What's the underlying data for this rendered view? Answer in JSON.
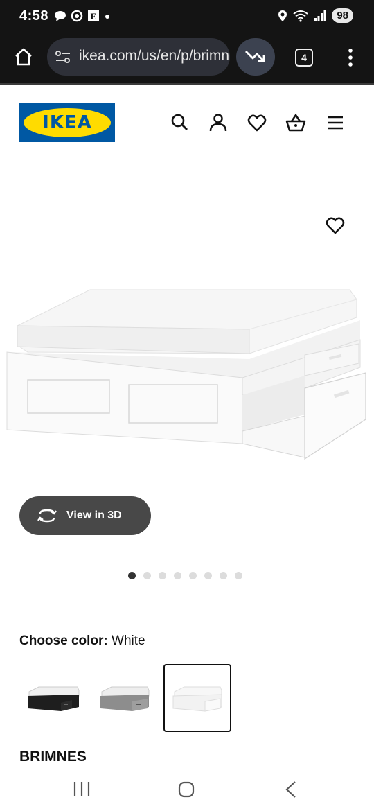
{
  "status_bar": {
    "time": "4:58",
    "battery": "98"
  },
  "browser": {
    "url": "ikea.com/us/en/p/brimnes",
    "tab_count": "4"
  },
  "header": {
    "logo_text": "IKEA"
  },
  "product": {
    "view_3d_label": "View in 3D",
    "gallery": {
      "total": 8,
      "active_index": 0
    },
    "choose_color_label": "Choose color:",
    "selected_color": "White",
    "color_options": [
      "black",
      "gray",
      "white"
    ],
    "name": "BRIMNES"
  },
  "colors": {
    "ikea_blue": "#0058a3",
    "ikea_yellow": "#ffdb00",
    "button_dark": "#484848"
  }
}
